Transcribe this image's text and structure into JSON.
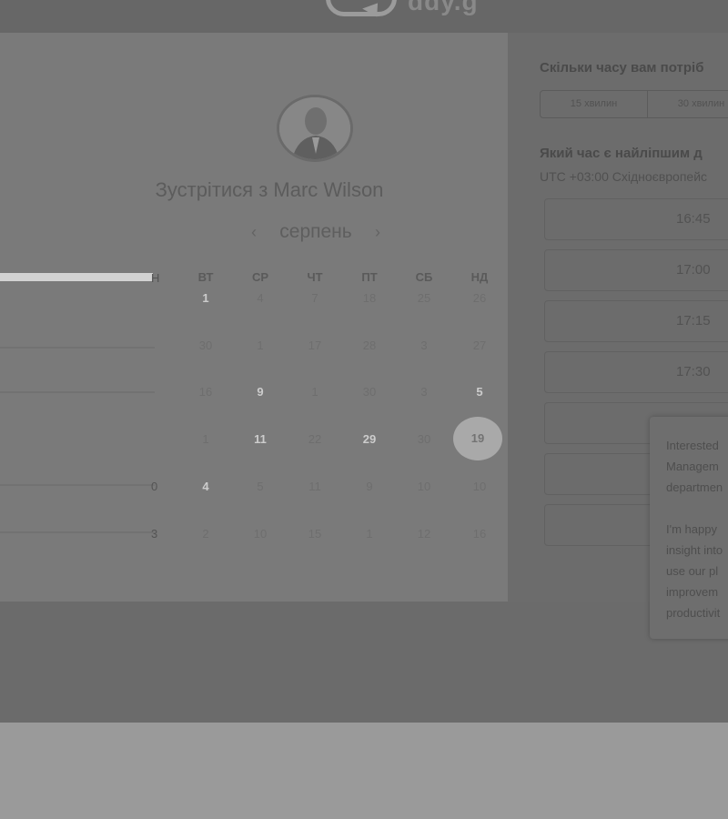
{
  "app": {
    "logo_text": "ddy.g"
  },
  "meeting": {
    "title": "Зустрітися з Marc Wilson",
    "month": "серпень",
    "prev_arrow": "‹",
    "next_arrow": "›"
  },
  "calendar": {
    "weekdays": [
      "ВТ",
      "СР",
      "ЧТ",
      "ПТ",
      "СБ",
      "НД"
    ],
    "weekday_partial": "Н",
    "sidebar_numbers": [
      "0",
      "3"
    ],
    "rows": [
      [
        "1",
        "4",
        "7",
        "18",
        "25",
        "26"
      ],
      [
        "30",
        "1",
        "17",
        "28",
        "3",
        "27"
      ],
      [
        "16",
        "9",
        "1",
        "30",
        "3",
        "5"
      ],
      [
        "1",
        "11",
        "22",
        "29",
        "30",
        "19"
      ],
      [
        "4",
        "5",
        "11",
        "9",
        "10",
        "10"
      ],
      [
        "2",
        "10",
        "15",
        "1",
        "12",
        "16"
      ]
    ],
    "bold_days": [
      "1",
      "9",
      "5",
      "11",
      "29",
      "4"
    ],
    "selected_day": "19"
  },
  "booking": {
    "duration_question": "Скільки часу вам потріб",
    "durations": [
      "15 хвилин",
      "30 хвилин"
    ],
    "time_question": "Який час є найліпшим д",
    "timezone": "UTC +03:00 Східноєвропейс",
    "slots": [
      "16:45",
      "17:00",
      "17:15",
      "17:30",
      "",
      "",
      ""
    ]
  },
  "chat": {
    "lines": [
      "Interested",
      "Managem",
      "departmen",
      "",
      "I'm happy",
      "insight into",
      "use our pl",
      "improvem",
      "productivit"
    ]
  }
}
